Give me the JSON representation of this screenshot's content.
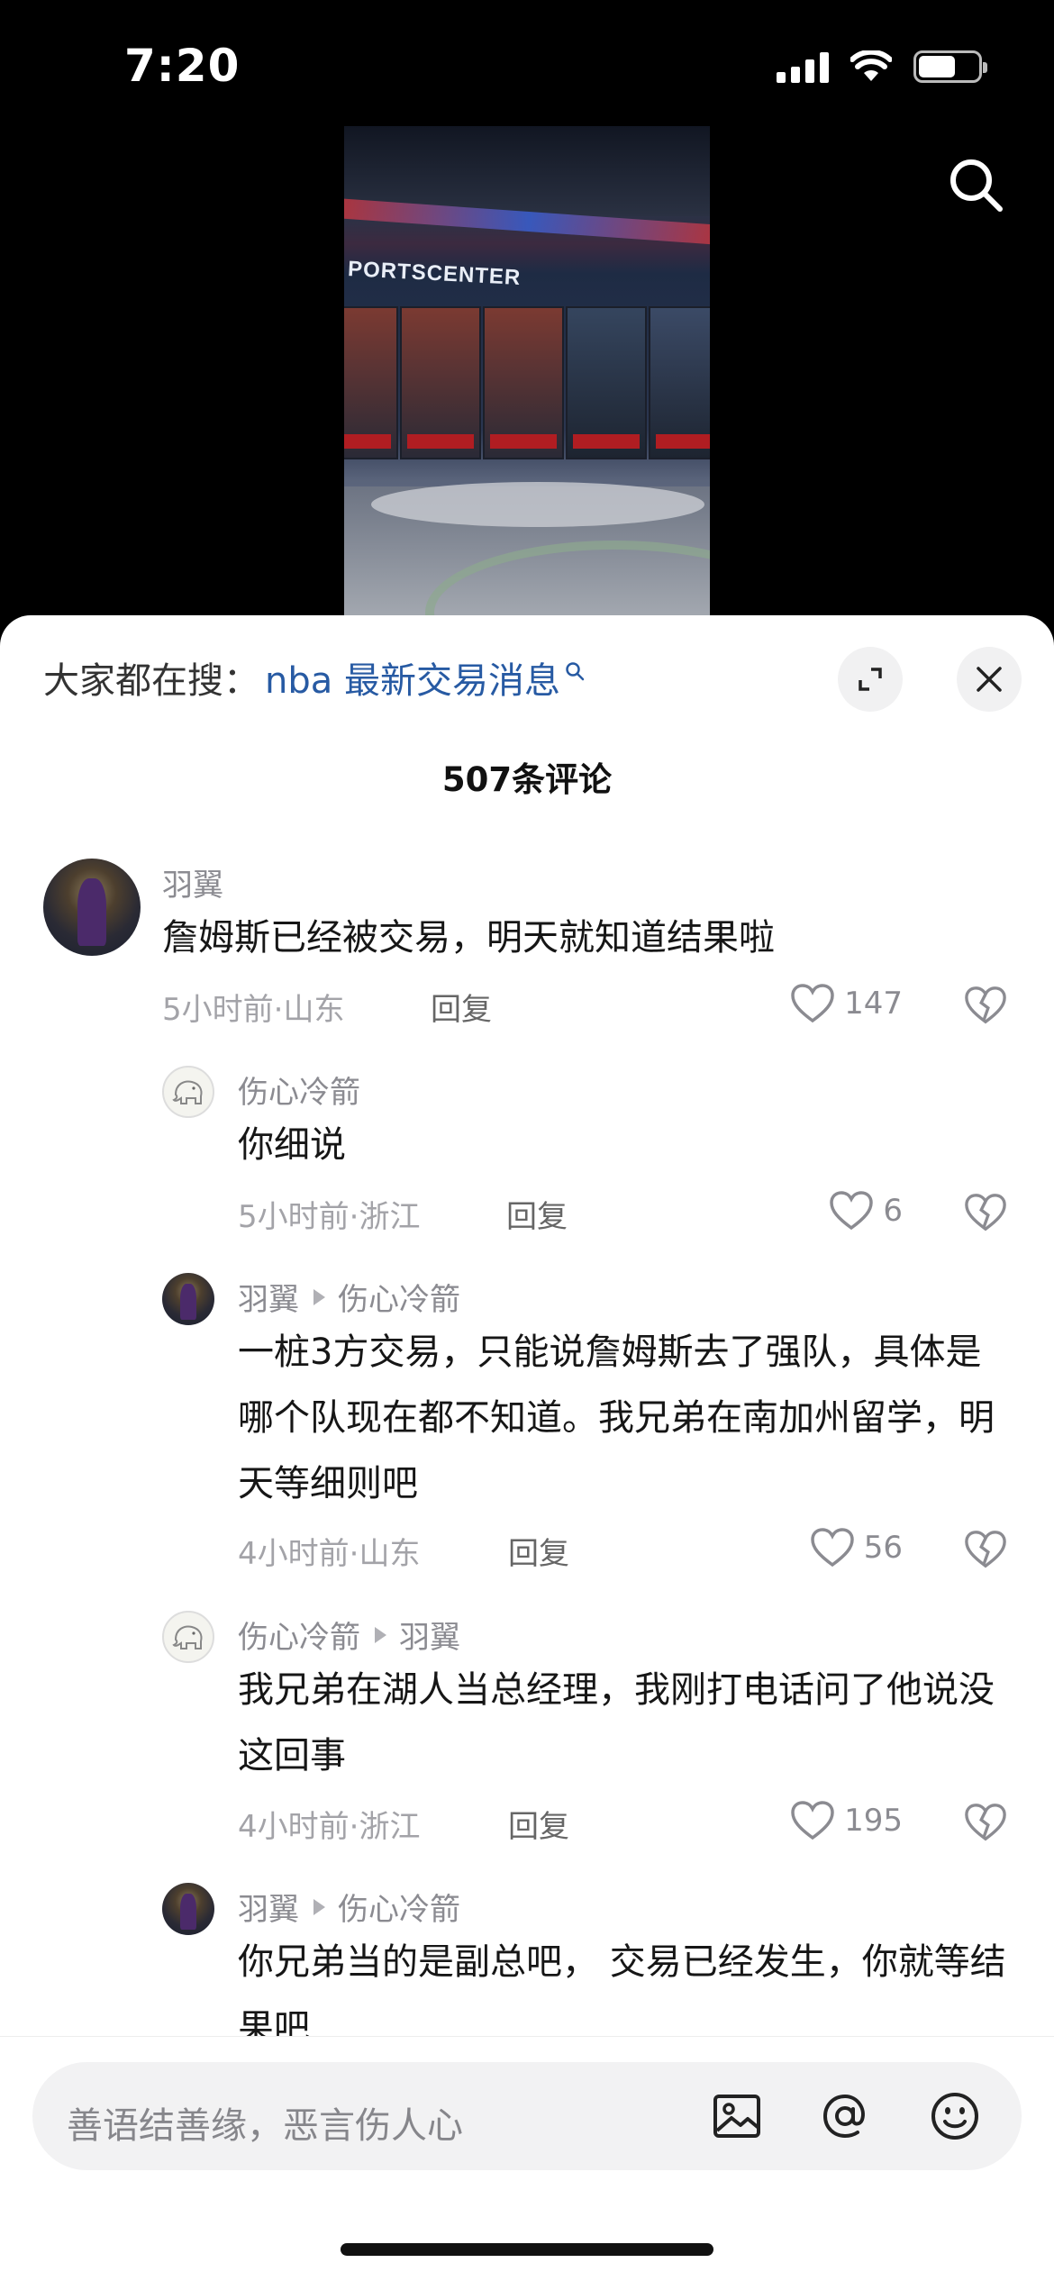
{
  "status_bar": {
    "time": "7:20"
  },
  "video": {
    "studio_text": "PORTSCENTER"
  },
  "sheet": {
    "hot_search_prefix": "大家都在搜：",
    "hot_search_keyword": "nba 最新交易消息",
    "comment_count": "507条评论",
    "reply_label": "回复"
  },
  "comments": [
    {
      "user": "羽翼",
      "text": "詹姆斯已经被交易，明天就知道结果啦",
      "meta": "5小时前·山东",
      "likes": "147"
    },
    {
      "user": "伤心冷箭",
      "text": "你细说",
      "meta": "5小时前·浙江",
      "likes": "6"
    },
    {
      "user": "羽翼",
      "reply_to": "伤心冷箭",
      "text": "一桩3方交易，只能说詹姆斯去了强队，具体是哪个队现在都不知道。我兄弟在南加州留学，明天等细则吧",
      "meta": "4小时前·山东",
      "likes": "56"
    },
    {
      "user": "伤心冷箭",
      "reply_to": "羽翼",
      "text": "我兄弟在湖人当总经理，我刚打电话问了他说没这回事",
      "meta": "4小时前·浙江",
      "likes": "195"
    },
    {
      "user": "羽翼",
      "reply_to": "伤心冷箭",
      "text": "你兄弟当的是副总吧， 交易已经发生，你就等结果吧"
    }
  ],
  "input": {
    "placeholder": "善语结善缘，恶言伤人心"
  },
  "icons": [
    "search-icon",
    "expand-icon",
    "close-icon",
    "heart-icon",
    "broken-heart-icon",
    "image-icon",
    "at-icon",
    "emoji-icon"
  ]
}
